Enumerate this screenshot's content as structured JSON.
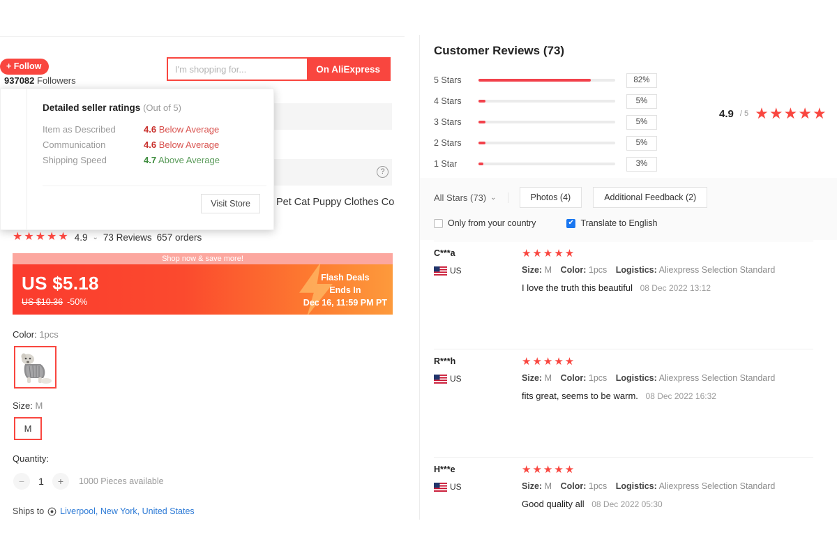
{
  "store": {
    "follow_label": "+ Follow",
    "followers_count": "937082",
    "followers_label": "Followers",
    "visit_store_label": "Visit Store"
  },
  "search": {
    "placeholder": "I'm shopping for...",
    "value": "",
    "button_label": "On AliExpress"
  },
  "seller_ratings": {
    "title": "Detailed seller ratings",
    "subtitle": "(Out of 5)",
    "rows": [
      {
        "label": "Item as Described",
        "score": "4.6",
        "verdict": "Below Average",
        "tone": "neg"
      },
      {
        "label": "Communication",
        "score": "4.6",
        "verdict": "Below Average",
        "tone": "neg"
      },
      {
        "label": "Shipping Speed",
        "score": "4.7",
        "verdict": "Above Average",
        "tone": "pos"
      }
    ]
  },
  "product": {
    "title": "Pet Cat Puppy Clothes Cos",
    "stars": "★★★★★",
    "rating": "4.9",
    "reviews_label": "73 Reviews",
    "orders_label": "657 orders"
  },
  "deal": {
    "promo_label": "Shop now & save more!",
    "price": "US $5.18",
    "original_price": "US $10.36",
    "discount": "-50%",
    "badge_line1": "Flash Deals",
    "badge_line2": "Ends In",
    "badge_line3": "Dec 16, 11:59 PM PT"
  },
  "sku": {
    "color_label": "Color:",
    "color_value": "1pcs",
    "size_label": "Size:",
    "size_value": "M",
    "size_option": "M",
    "quantity_label": "Quantity:",
    "quantity_value": "1",
    "stock_text": "1000 Pieces available",
    "ships_to_label": "Ships to",
    "ships_to_address": "Liverpool, New York, United States"
  },
  "reviews_panel": {
    "heading": "Customer Reviews (73)",
    "overall_score": "4.9",
    "overall_out_of": "/ 5",
    "overall_stars": "★★★★★",
    "distribution": [
      {
        "label": "5 Stars",
        "percent": "82%",
        "value": 82
      },
      {
        "label": "4 Stars",
        "percent": "5%",
        "value": 5
      },
      {
        "label": "3 Stars",
        "percent": "5%",
        "value": 5
      },
      {
        "label": "2 Stars",
        "percent": "5%",
        "value": 5
      },
      {
        "label": "1 Star",
        "percent": "3%",
        "value": 3
      }
    ],
    "filters": {
      "all_stars_label": "All Stars (73)",
      "photos_label": "Photos (4)",
      "additional_feedback_label": "Additional Feedback (2)",
      "only_country_label": "Only from your country",
      "only_country_checked": false,
      "translate_label": "Translate to English",
      "translate_checked": true
    },
    "reviews": [
      {
        "user": "C***a",
        "country": "US",
        "stars": "★★★★★",
        "size_key": "Size:",
        "size_val": "M",
        "color_key": "Color:",
        "color_val": "1pcs",
        "logistics_key": "Logistics:",
        "logistics_val": "Aliexpress Selection Standard",
        "text": "I love the truth this beautiful",
        "date": "08 Dec 2022 13:12"
      },
      {
        "user": "R***h",
        "country": "US",
        "stars": "★★★★★",
        "size_key": "Size:",
        "size_val": "M",
        "color_key": "Color:",
        "color_val": "1pcs",
        "logistics_key": "Logistics:",
        "logistics_val": "Aliexpress Selection Standard",
        "text": "fits great, seems to be warm.",
        "date": "08 Dec 2022 16:32"
      },
      {
        "user": "H***e",
        "country": "US",
        "stars": "★★★★★",
        "size_key": "Size:",
        "size_val": "M",
        "color_key": "Color:",
        "color_val": "1pcs",
        "logistics_key": "Logistics:",
        "logistics_val": "Aliexpress Selection Standard",
        "text": "Good quality all",
        "date": "08 Dec 2022 05:30"
      }
    ]
  },
  "colors": {
    "brand_red": "#f9463f",
    "bar_red": "#f2414b",
    "link_blue": "#2e7bd6",
    "checkbox_blue": "#1976f0",
    "negative": "#c9302c",
    "positive": "#3f8c3f"
  }
}
